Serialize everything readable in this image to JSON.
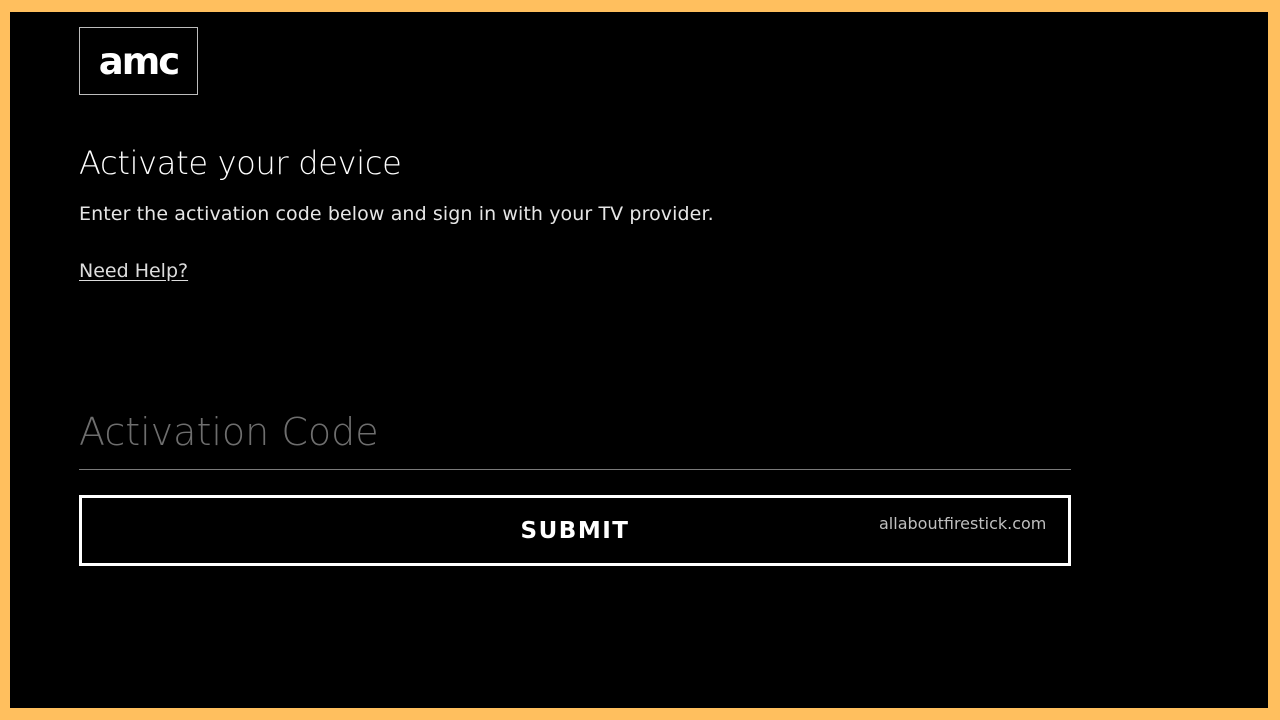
{
  "brand": {
    "logo_text": "amc"
  },
  "page": {
    "title": "Activate your device",
    "subtitle": "Enter the activation code below and sign in with your TV provider.",
    "help_link": "Need Help?"
  },
  "form": {
    "code_placeholder": "Activation Code",
    "code_value": "",
    "submit_label": "SUBMIT"
  },
  "watermark": "allaboutfirestick.com",
  "colors": {
    "frame_border": "#FFBF5E",
    "background": "#000000",
    "text": "#FFFFFF",
    "placeholder": "#6E6E6E"
  }
}
